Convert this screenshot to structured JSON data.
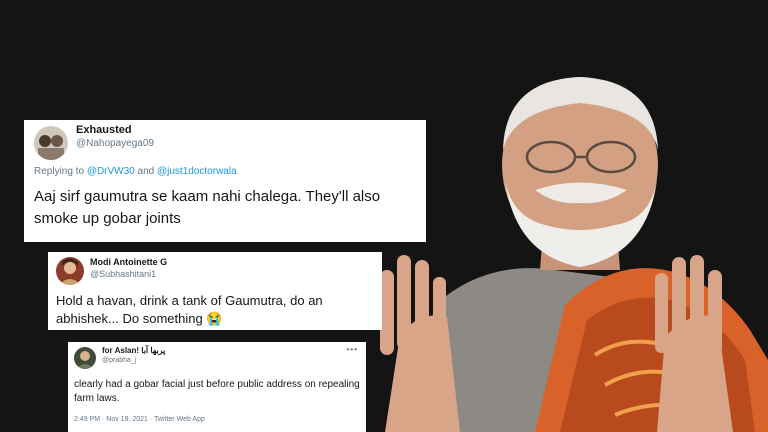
{
  "tweets": [
    {
      "name": "Exhausted",
      "handle": "@Nahopayega09",
      "reply_prefix": "Replying to ",
      "reply_user1": "@DrVW30",
      "reply_and": " and ",
      "reply_user2": "@just1doctorwala",
      "text": "Aaj sirf gaumutra se kaam nahi chalega. They'll also smoke up gobar joints"
    },
    {
      "name": "Modi Antoinette G",
      "handle": "@Subhashitani1",
      "text": "Hold a havan, drink a tank of Gaumutra, do an abhishek... Do something",
      "emoji": "😭"
    },
    {
      "name": "for Aslan! پربھا آبا",
      "handle": "@prabha_j",
      "text": "clearly had a gobar facial just before public address on repealing farm laws.",
      "footer": "2:49 PM · Nov 19, 2021 · Twitter Web App",
      "more": "•••"
    }
  ],
  "colors": {
    "background": "#141414",
    "card": "#ffffff",
    "link": "#1b95e0",
    "secondary_text": "#657786",
    "shawl": "#d9622b"
  },
  "icons": [
    "more-options-icon",
    "crying-face-emoji"
  ]
}
